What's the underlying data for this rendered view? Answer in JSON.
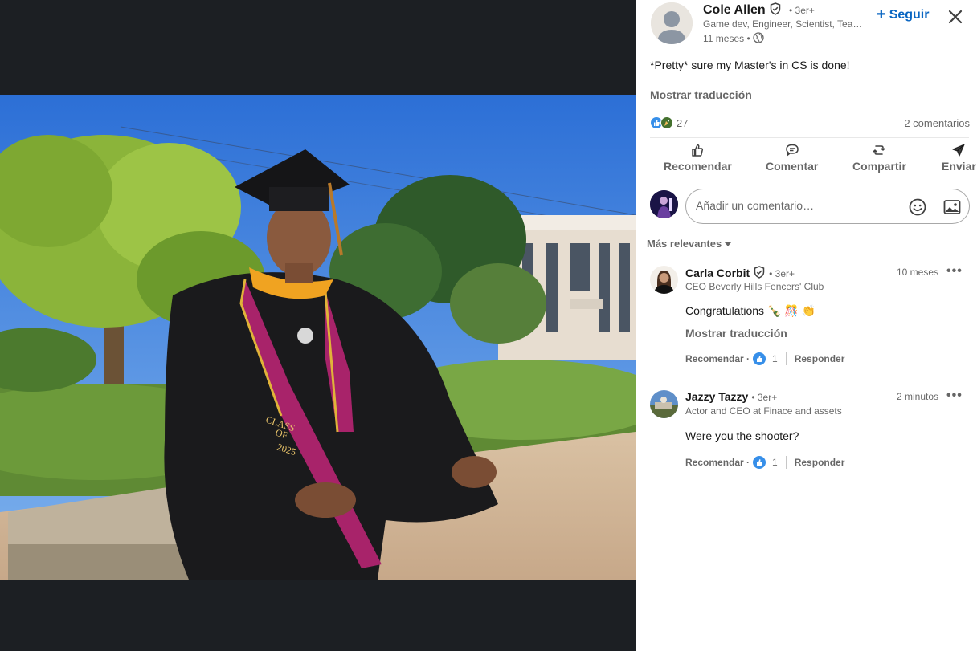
{
  "post": {
    "author": {
      "name": "Cole Allen",
      "degree": "• 3er+",
      "headline": "Game dev, Engineer, Scientist, Tea…",
      "time": "11 meses •"
    },
    "follow_label": "Seguir",
    "text": "*Pretty* sure my Master's in CS is done!",
    "show_translation": "Mostrar traducción",
    "reactions_count": "27",
    "comments_count": "2 comentarios",
    "photo_text": {
      "line1": "CLASS",
      "line2": "OF",
      "line3": "2025"
    }
  },
  "actions": [
    {
      "label": "Recomendar",
      "icon": "thumbs-up-icon"
    },
    {
      "label": "Comentar",
      "icon": "comment-icon"
    },
    {
      "label": "Compartir",
      "icon": "repost-icon"
    },
    {
      "label": "Enviar",
      "icon": "send-icon"
    }
  ],
  "comment_box": {
    "placeholder": "Añadir un comentario…"
  },
  "sort_label": "Más relevantes",
  "comments": [
    {
      "name": "Carla Corbit",
      "degree": "• 3er+",
      "headline": "CEO Beverly Hills Fencers' Club",
      "time": "10 meses",
      "text": "Congratulations 🍾 🎊 👏",
      "show_translation": "Mostrar traducción",
      "like_label": "Recomendar ·",
      "like_count": "1",
      "reply_label": "Responder"
    },
    {
      "name": "Jazzy Tazzy",
      "degree": "• 3er+",
      "headline": "Actor and CEO at Finace and assets",
      "time": "2 minutos",
      "text": "Were you the shooter?",
      "like_label": "Recomendar ·",
      "like_count": "1",
      "reply_label": "Responder"
    }
  ],
  "colors": {
    "link_blue": "#0a66c2",
    "viewer_bg": "#1c1f23",
    "like_blue": "#378fe9"
  }
}
